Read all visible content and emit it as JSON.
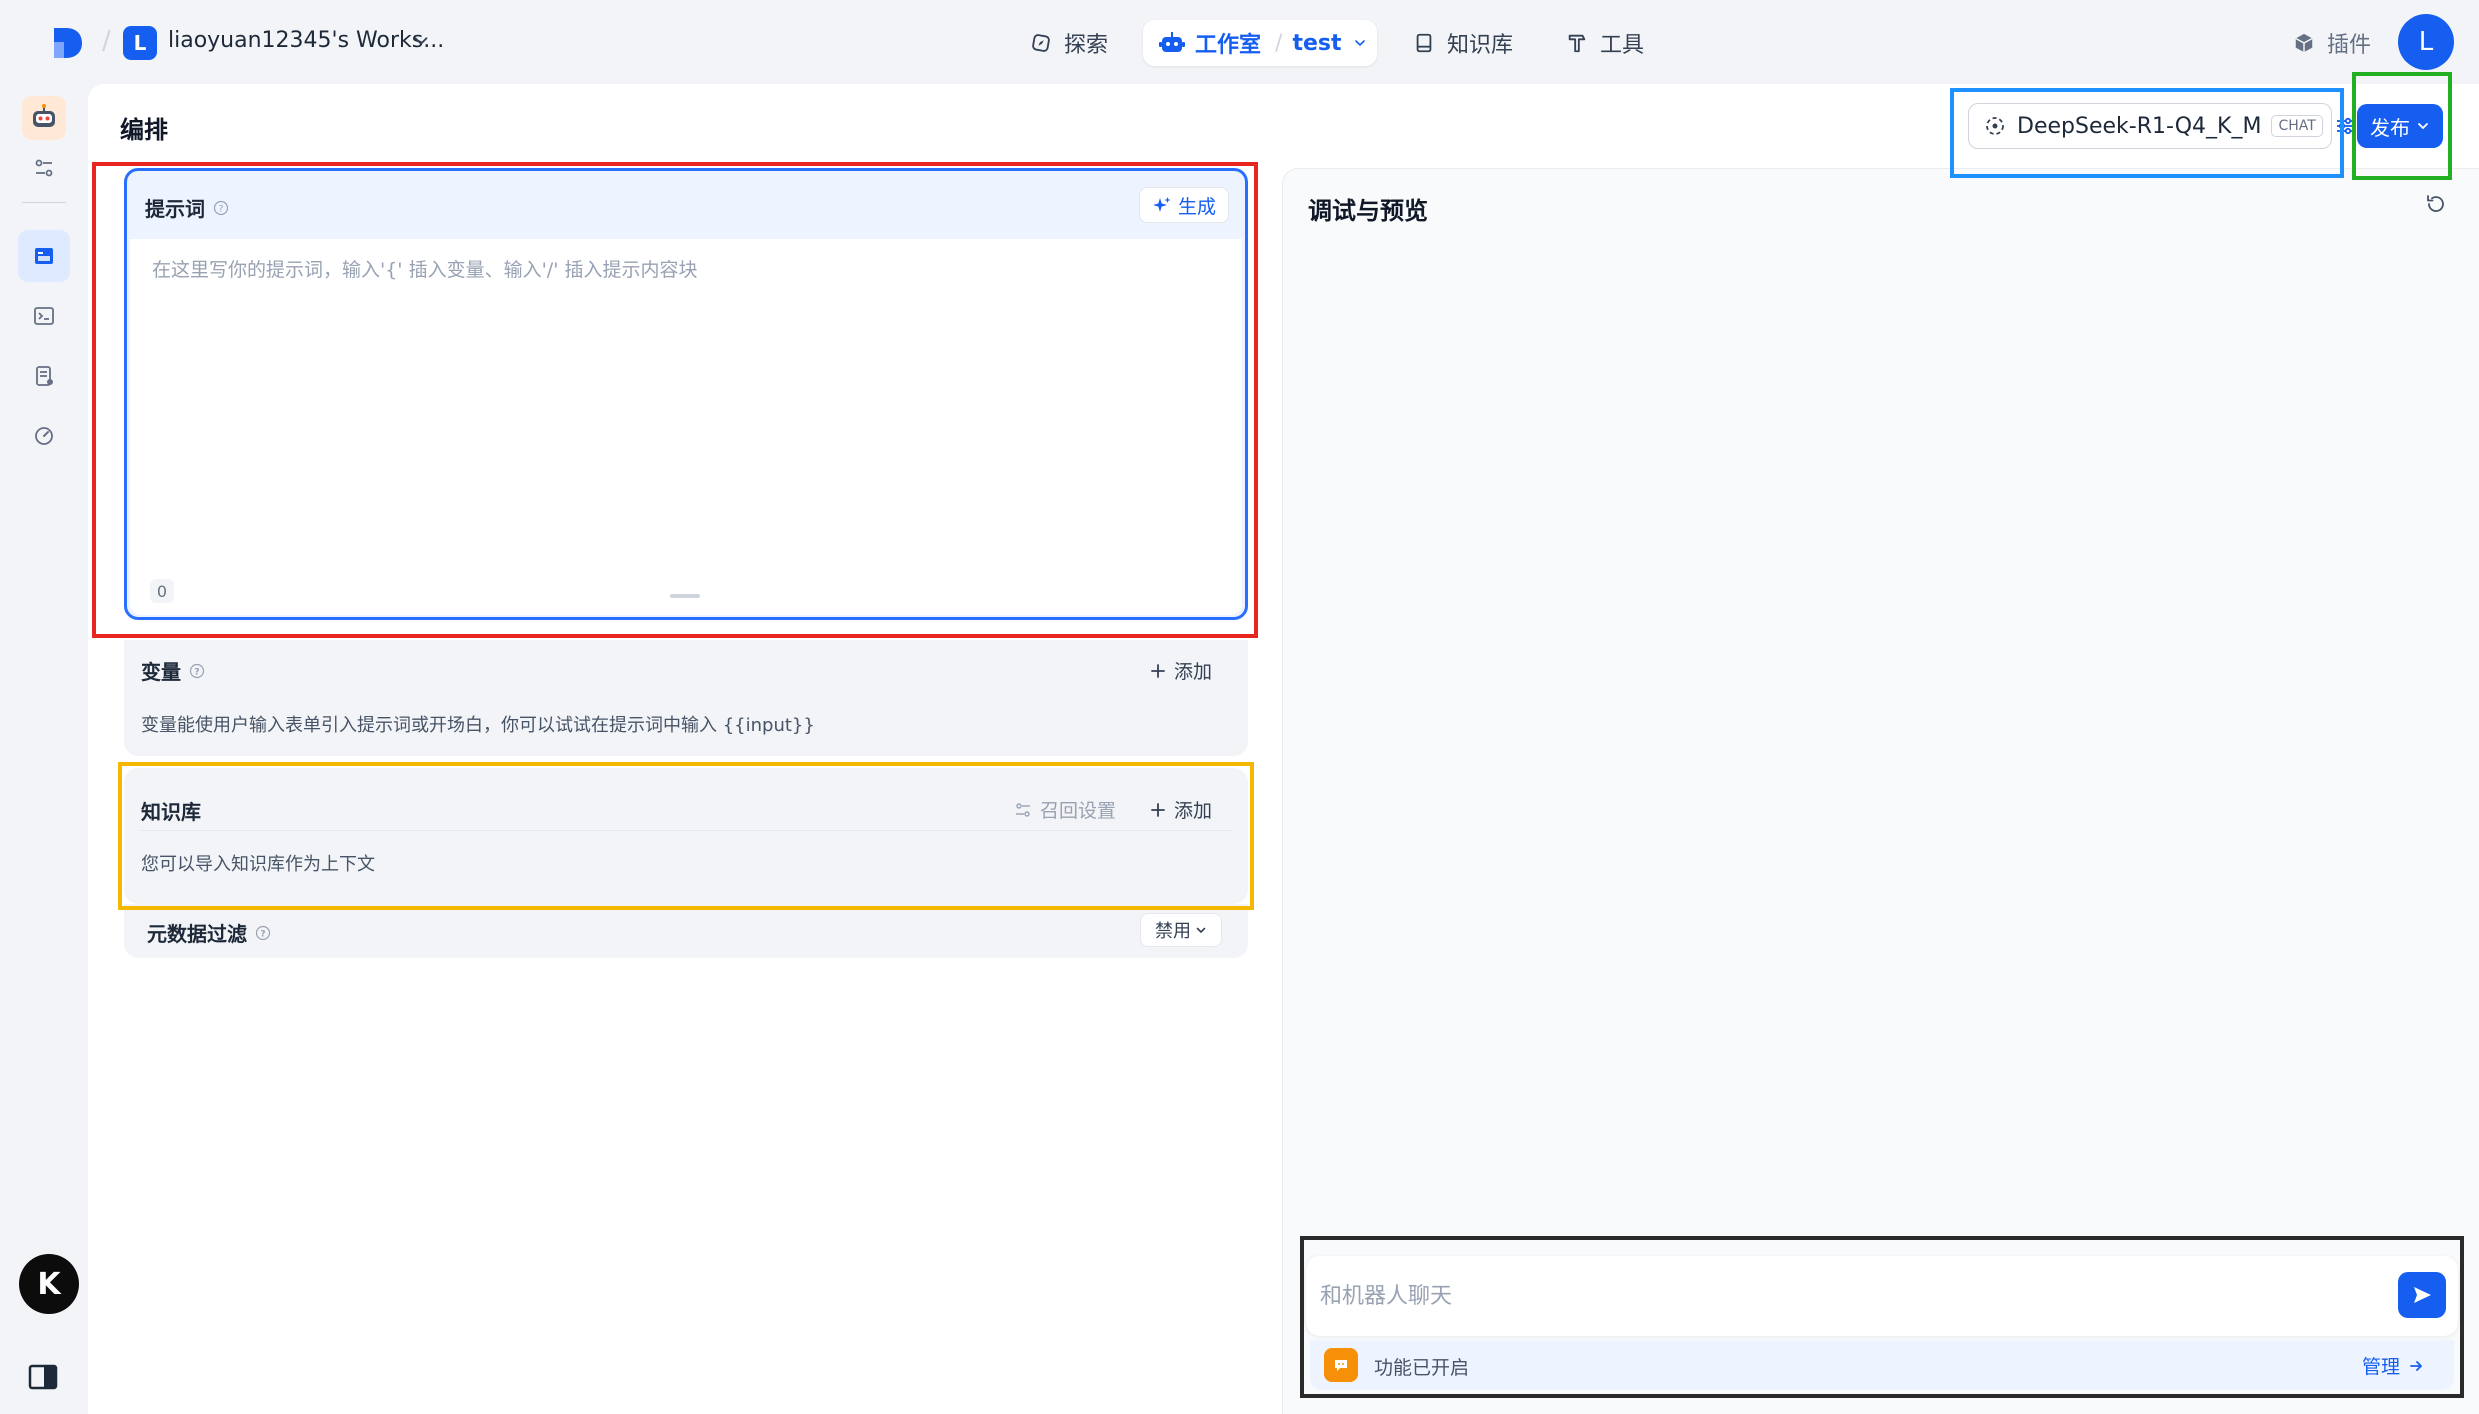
{
  "colors": {
    "accent": "#155eef",
    "annotation_red": "#e8261f",
    "annotation_yellow": "#f5b800",
    "annotation_blue": "#1e90ff",
    "annotation_green": "#22b022",
    "annotation_dark": "#2b2b2b"
  },
  "topnav": {
    "workspace_initial": "L",
    "workspace_name": "liaoyuan12345's Works...",
    "explore_label": "探索",
    "studio_label": "工作室",
    "app_name": "test",
    "knowledge_label": "知识库",
    "tools_label": "工具",
    "plugins_label": "插件",
    "user_initial": "L"
  },
  "rail": {
    "icons": [
      "app-icon",
      "settings-sliders-icon",
      "orchestrate-icon",
      "terminal-icon",
      "logs-icon",
      "monitor-icon"
    ],
    "bottom_logo": "K"
  },
  "header": {
    "title": "编排",
    "model_name": "DeepSeek-R1-Q4_K_M",
    "model_badge": "CHAT",
    "publish_label": "发布"
  },
  "prompt": {
    "title": "提示词",
    "generate_label": "生成",
    "placeholder": "在这里写你的提示词，输入'{' 插入变量、输入'/' 插入提示内容块",
    "char_count": "0"
  },
  "variables": {
    "title": "变量",
    "add_label": "添加",
    "description": "变量能使用户输入表单引入提示词或开场白，你可以试试在提示词中输入 {{input}}"
  },
  "knowledge": {
    "title": "知识库",
    "recall_label": "召回设置",
    "add_label": "添加",
    "description": "您可以导入知识库作为上下文"
  },
  "metadata_filter": {
    "title": "元数据过滤",
    "value": "禁用"
  },
  "debug": {
    "title": "调试与预览",
    "chat_placeholder": "和机器人聊天",
    "feature_text": "功能已开启",
    "manage_label": "管理"
  }
}
